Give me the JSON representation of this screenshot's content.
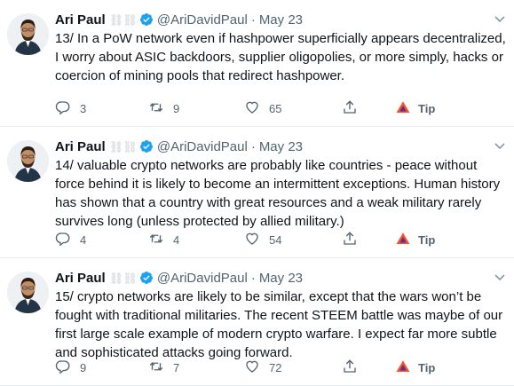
{
  "tweets": [
    {
      "name": "Ari Paul",
      "links_glyph": "⛓⛓",
      "handle": "@AriDavidPaul",
      "dot": "·",
      "date": "May 23",
      "text": "13/ In a PoW network even if hashpower superficially appears decentralized, I worry about ASIC backdoors, supplier oligopolies, or more simply, hacks or coercion of mining pools that redirect hashpower.",
      "replies": "3",
      "retweets": "9",
      "likes": "65",
      "tip": "Tip"
    },
    {
      "name": "Ari Paul",
      "links_glyph": "⛓⛓",
      "handle": "@AriDavidPaul",
      "dot": "·",
      "date": "May 23",
      "text": "14/ valuable crypto networks are probably like countries - peace without force behind it is likely to become an intermittent exceptions.  Human history has shown that a country with great resources and a weak military rarely survives long (unless protected by allied military.)",
      "replies": "4",
      "retweets": "4",
      "likes": "54",
      "tip": "Tip"
    },
    {
      "name": "Ari Paul",
      "links_glyph": "⛓⛓",
      "handle": "@AriDavidPaul",
      "dot": "·",
      "date": "May 23",
      "text": "15/ crypto networks are likely to be similar, except that the wars won’t be fought with traditional militaries.  The recent STEEM battle was maybe of our first large scale example of modern crypto warfare.  I expect far more subtle and sophisticated attacks going forward.",
      "replies": "9",
      "retweets": "7",
      "likes": "72",
      "tip": "Tip"
    }
  ],
  "colors": {
    "verified": "#1da1f2",
    "icon_gray": "#536471",
    "brave_orange": "#fb542b",
    "brave_purple": "#662d91"
  },
  "icons": {
    "verified": "verified-badge-icon",
    "chevron": "chevron-down-icon",
    "reply": "reply-icon",
    "retweet": "retweet-icon",
    "like": "heart-icon",
    "share": "share-icon",
    "tip": "brave-triangle-icon"
  }
}
